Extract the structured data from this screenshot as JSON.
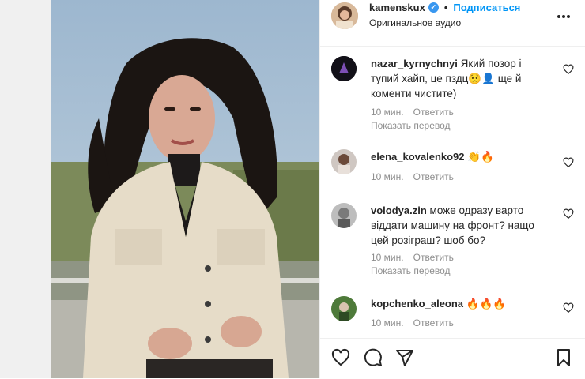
{
  "post": {
    "username": "kamenskux",
    "follow_label": "Подписаться",
    "audio_label": "Оригинальное аудио",
    "more_label": "•••"
  },
  "comments": [
    {
      "username": "nazar_kyrnychnyi",
      "text": " Який позор і тупий хайп, це пздц😟👤 ще й коменти чистите)",
      "time": "10 мин.",
      "reply": "Ответить",
      "translate": "Показать перевод"
    },
    {
      "username": "elena_kovalenko92",
      "text": " 👏🔥",
      "time": "10 мин.",
      "reply": "Ответить"
    },
    {
      "username": "volodya.zin",
      "text": " може одразу варто віддати машину на фронт? нащо цей розіграш? шоб бо?",
      "time": "10 мин.",
      "reply": "Ответить",
      "translate": "Показать перевод"
    },
    {
      "username": "kopchenko_aleona",
      "text": " 🔥🔥🔥",
      "time": "10 мин.",
      "reply": "Ответить"
    }
  ],
  "icons": {
    "like": "heart-icon",
    "comment": "comment-icon",
    "share": "send-icon",
    "save": "bookmark-icon",
    "more": "more-icon",
    "verified": "verified-badge-icon"
  },
  "colors": {
    "accent": "#0095f6",
    "muted": "#8e8e8e",
    "text": "#262626",
    "verified": "#3897f0"
  }
}
